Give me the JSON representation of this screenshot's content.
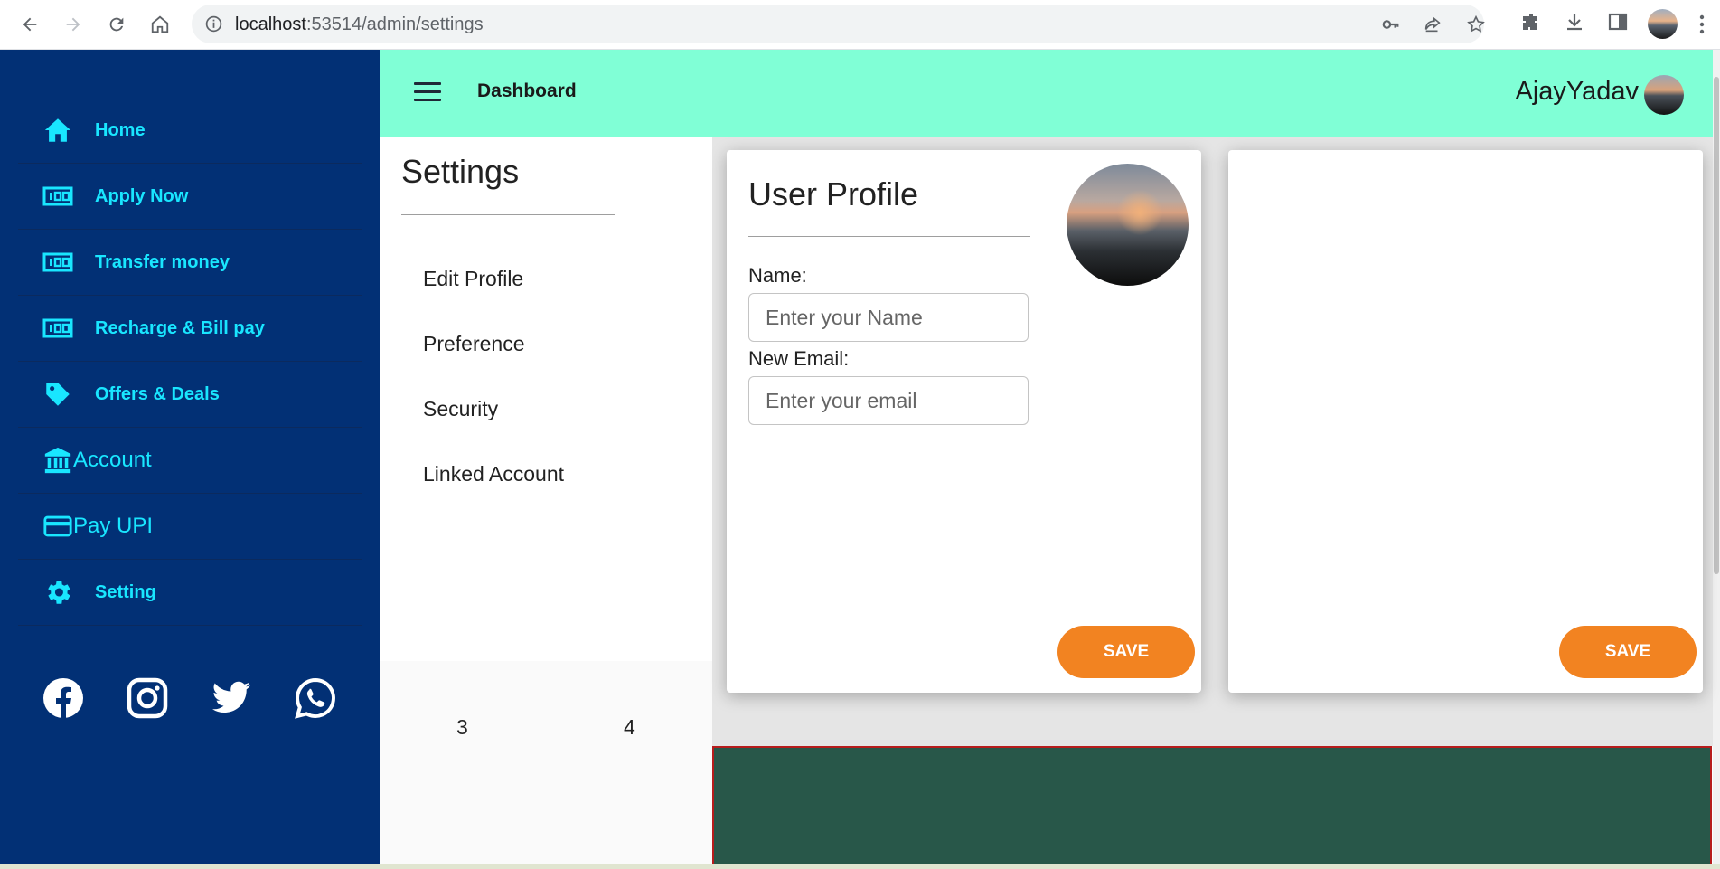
{
  "browser": {
    "url_host": "localhost",
    "url_rest": ":53514/admin/settings"
  },
  "sidebar": {
    "items": [
      {
        "label": "Home",
        "icon": "home-icon"
      },
      {
        "label": "Apply Now",
        "icon": "money-icon"
      },
      {
        "label": "Transfer money",
        "icon": "money-icon"
      },
      {
        "label": "Recharge & Bill pay",
        "icon": "money-icon"
      },
      {
        "label": "Offers & Deals",
        "icon": "tag-icon"
      },
      {
        "label": "Account",
        "icon": "bank-icon"
      },
      {
        "label": "Pay UPI",
        "icon": "card-icon"
      },
      {
        "label": "Setting",
        "icon": "gear-icon"
      }
    ],
    "socials": [
      "facebook-icon",
      "instagram-icon",
      "twitter-icon",
      "whatsapp-icon"
    ]
  },
  "header": {
    "title": "Dashboard",
    "user_name": "AjayYadav"
  },
  "settings": {
    "heading": "Settings",
    "links": [
      "Edit Profile",
      "Preference",
      "Security",
      "Linked Account"
    ],
    "pager": [
      "3",
      "4"
    ]
  },
  "profile_card": {
    "title": "User Profile",
    "name_label": "Name:",
    "name_placeholder": "Enter your Name",
    "email_label": "New Email:",
    "email_placeholder": "Enter your email",
    "save_label": "SAVE"
  },
  "second_card": {
    "save_label": "SAVE"
  },
  "colors": {
    "sidebar_bg": "#023075",
    "sidebar_text": "#19e6ff",
    "header_bg": "#80ffd6",
    "button_bg": "#f28321",
    "bottom_block": "#285749"
  }
}
